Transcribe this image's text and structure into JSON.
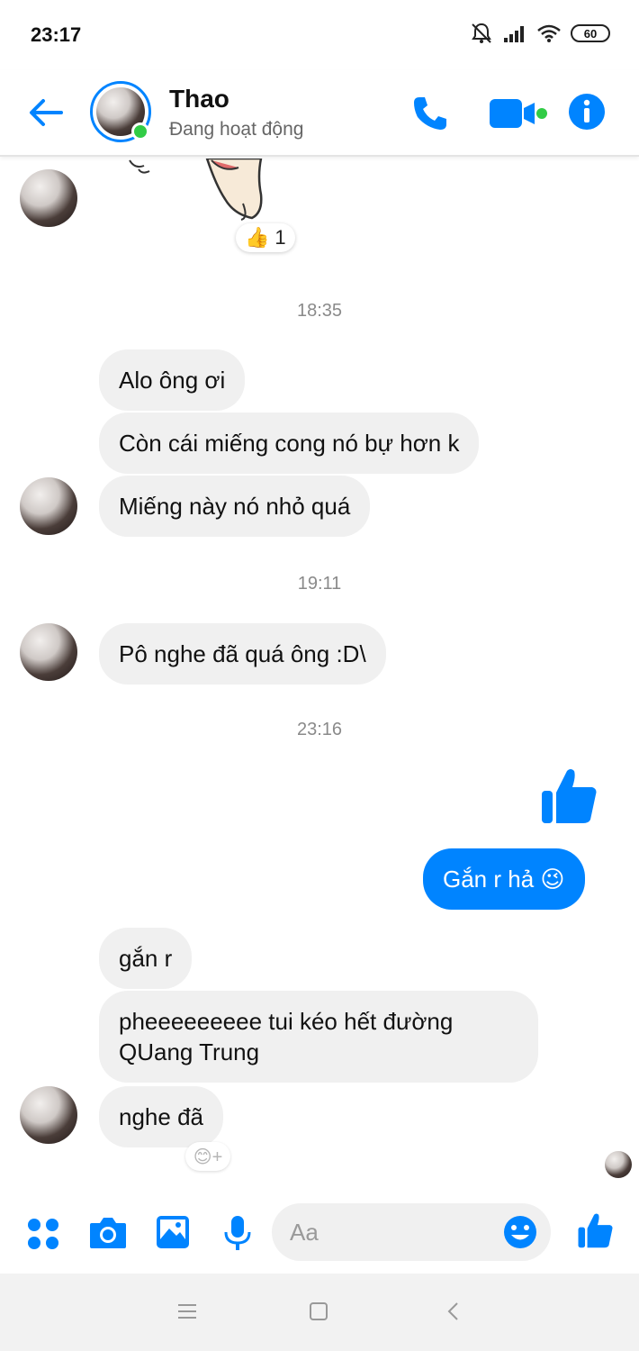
{
  "status_bar": {
    "time": "23:17",
    "battery": "60",
    "icons": [
      "mute-icon",
      "signal-icon",
      "wifi-icon",
      "battery-icon"
    ]
  },
  "header": {
    "back_icon": "arrow-left-icon",
    "name": "Thao",
    "status": "Đang hoạt động",
    "actions": [
      "phone-icon",
      "video-call-icon",
      "info-icon"
    ],
    "accent_color": "#0084ff",
    "online_color": "#31cc46"
  },
  "conversation": {
    "sticker_reaction": {
      "emoji": "👍",
      "count": "1"
    },
    "timestamps": [
      "18:35",
      "19:11",
      "23:16"
    ],
    "group_1835": [
      "Alo ông ơi",
      "Còn cái miếng cong nó bự hơn k",
      "Miếng này nó nhỏ quá"
    ],
    "group_1911": [
      "Pô nghe đã quá ông :D\\"
    ],
    "mine": {
      "like_sticker": "thumbs-up-icon",
      "text": "Gắn r hả",
      "emoji": "😉"
    },
    "group_reply": [
      "gắn r",
      "pheeeeeeeee tui kéo hết đường QUang Trung",
      "nghe đã"
    ],
    "add_reaction": "😊+"
  },
  "composer": {
    "icons": [
      "apps-icon",
      "camera-icon",
      "image-icon",
      "mic-icon",
      "emoji-icon",
      "like-icon"
    ],
    "placeholder": "Aa"
  },
  "nav_bar": {
    "buttons": [
      "menu-icon",
      "home-icon",
      "back-icon"
    ]
  }
}
